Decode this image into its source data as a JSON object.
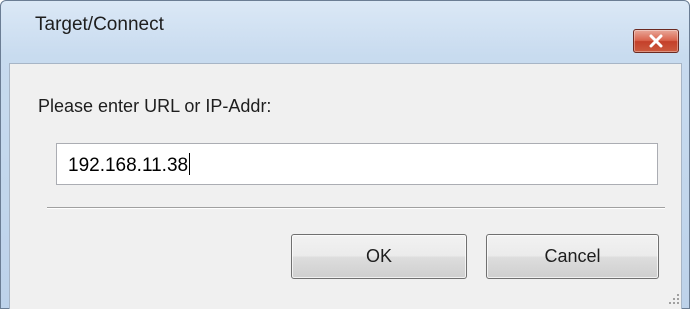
{
  "window": {
    "title": "Target/Connect",
    "close_icon": "close-x-icon",
    "close_color": "#c9452e"
  },
  "dialog": {
    "prompt_label": "Please enter URL or IP-Addr:",
    "url_value": "192.168.11.38"
  },
  "buttons": {
    "ok_label": "OK",
    "cancel_label": "Cancel"
  },
  "resize_grip_icon": "resize-grip-icon"
}
